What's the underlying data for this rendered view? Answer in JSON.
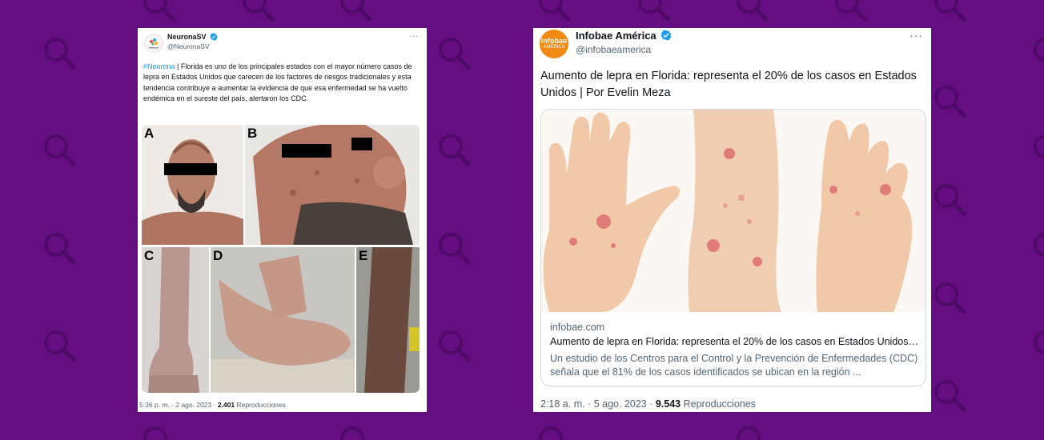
{
  "tweet1": {
    "name": "NeuronaSV",
    "handle": "@NeuronaSV",
    "more": "···",
    "hashtag": "#Neurona",
    "body": " | Florida es uno de los principales estados con el mayor número casos de lepra en Estados Unidos que carecen de los factores de riesgos tradicionales y esta tendencia contribuye a aumentar la evidencia de que esa enfermedad se ha vuelto endémica en el sureste del país, alertaron los CDC.",
    "photo_labels": [
      "A",
      "B",
      "C",
      "D",
      "E"
    ],
    "time": "5:36 p. m. · 2 ago. 2023 · ",
    "views_count": "2.401",
    "views_label": " Reproducciones",
    "avatar_icon": "neurona-logo-icon"
  },
  "tweet2": {
    "name": "Infobae América",
    "handle": "@infobaeamerica",
    "more": "···",
    "avatar_line1": "infobae",
    "avatar_line2": "AMÉRICA",
    "body": "Aumento de lepra en Florida: representa el 20% de los casos en Estados Unidos | Por Evelin Meza",
    "link": {
      "domain": "infobae.com",
      "title": "Aumento de lepra en Florida: representa el 20% de los casos en Estados Unidos | Por Evelin Meza",
      "description": "Un estudio de los Centros para el Control y la Prevención de Enfermedades (CDC) señala que el 81% de los casos identificados se ubican en la región ..."
    },
    "time": "2:18 a. m. · 5 ago. 2023 · ",
    "views_count": "9.543",
    "views_label": " Reproducciones"
  },
  "colors": {
    "background": "#640e82",
    "pattern": "#4f0a68",
    "verified": "#1d9bf0",
    "hashtag": "#1d9bf0",
    "infobae_orange": "#f08a12"
  }
}
